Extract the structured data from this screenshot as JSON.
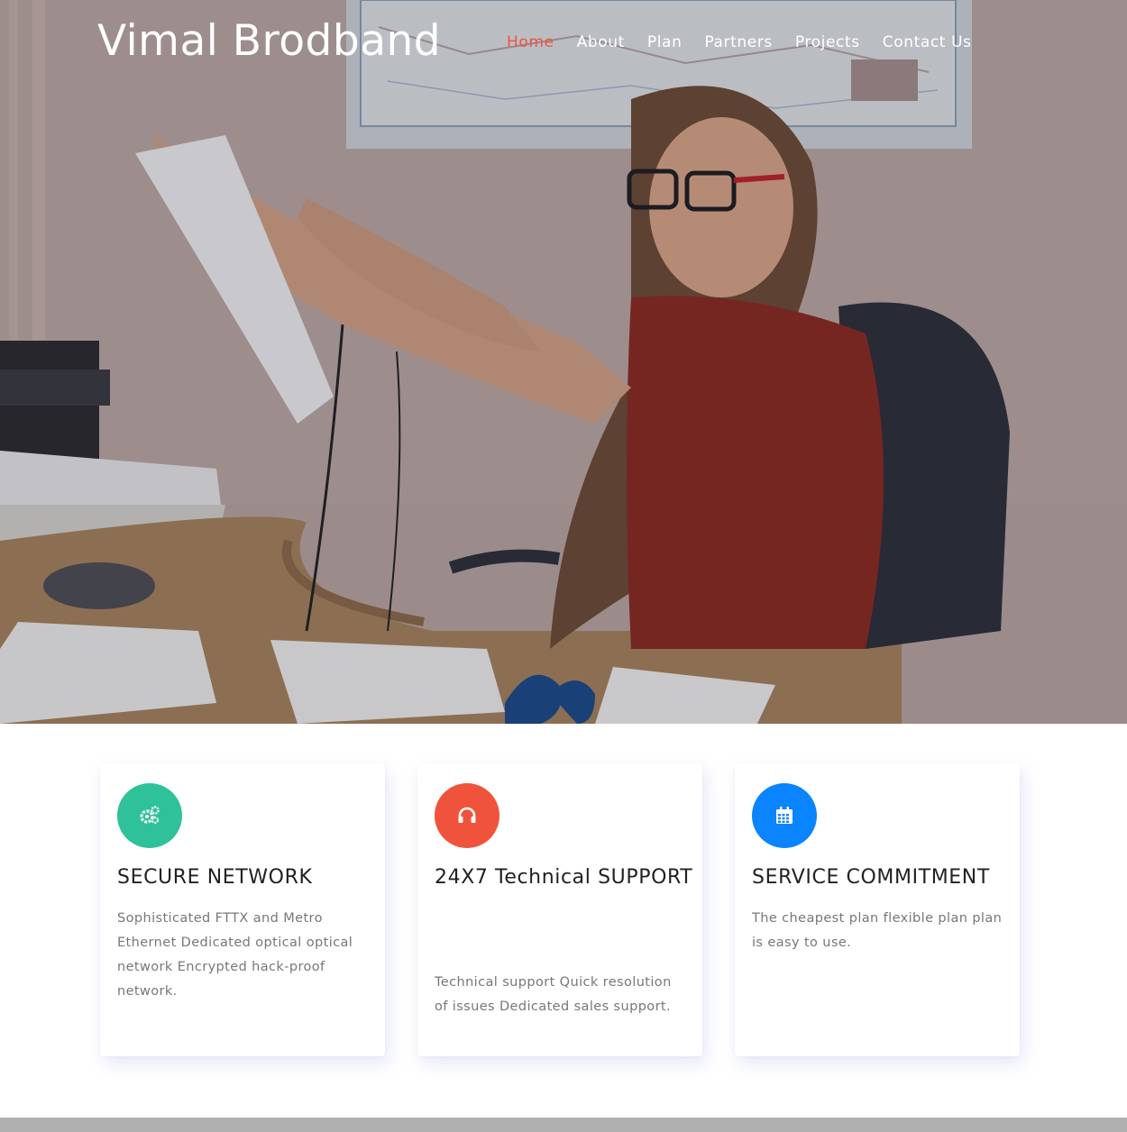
{
  "brand": {
    "name": "Vimal Brodband"
  },
  "nav": {
    "items": [
      {
        "label": "Home",
        "active": true
      },
      {
        "label": "About"
      },
      {
        "label": "Plan"
      },
      {
        "label": "Partners"
      },
      {
        "label": "Projects"
      },
      {
        "label": "Contact Us"
      }
    ]
  },
  "hero": {
    "image": "woman-at-office-desk-holding-paper"
  },
  "features": [
    {
      "icon": "gears-icon",
      "color": "#2ec19a",
      "title": "SECURE NETWORK",
      "text": "Sophisticated FTTX and Metro Ethernet Dedicated optical optical network Encrypted hack-proof network."
    },
    {
      "icon": "headphones-icon",
      "color": "#f0533b",
      "title": "24X7 Technical SUPPORT",
      "text": "Technical support Quick resolution of issues Dedicated sales support."
    },
    {
      "icon": "calendar-icon",
      "color": "#0a84ff",
      "title": "SERVICE COMMITMENT",
      "text": "The cheapest plan flexible plan plan is easy to use."
    }
  ],
  "colors": {
    "accent": "#f0533b",
    "green": "#2ec19a",
    "blue": "#0a84ff",
    "body_text": "#777777"
  }
}
